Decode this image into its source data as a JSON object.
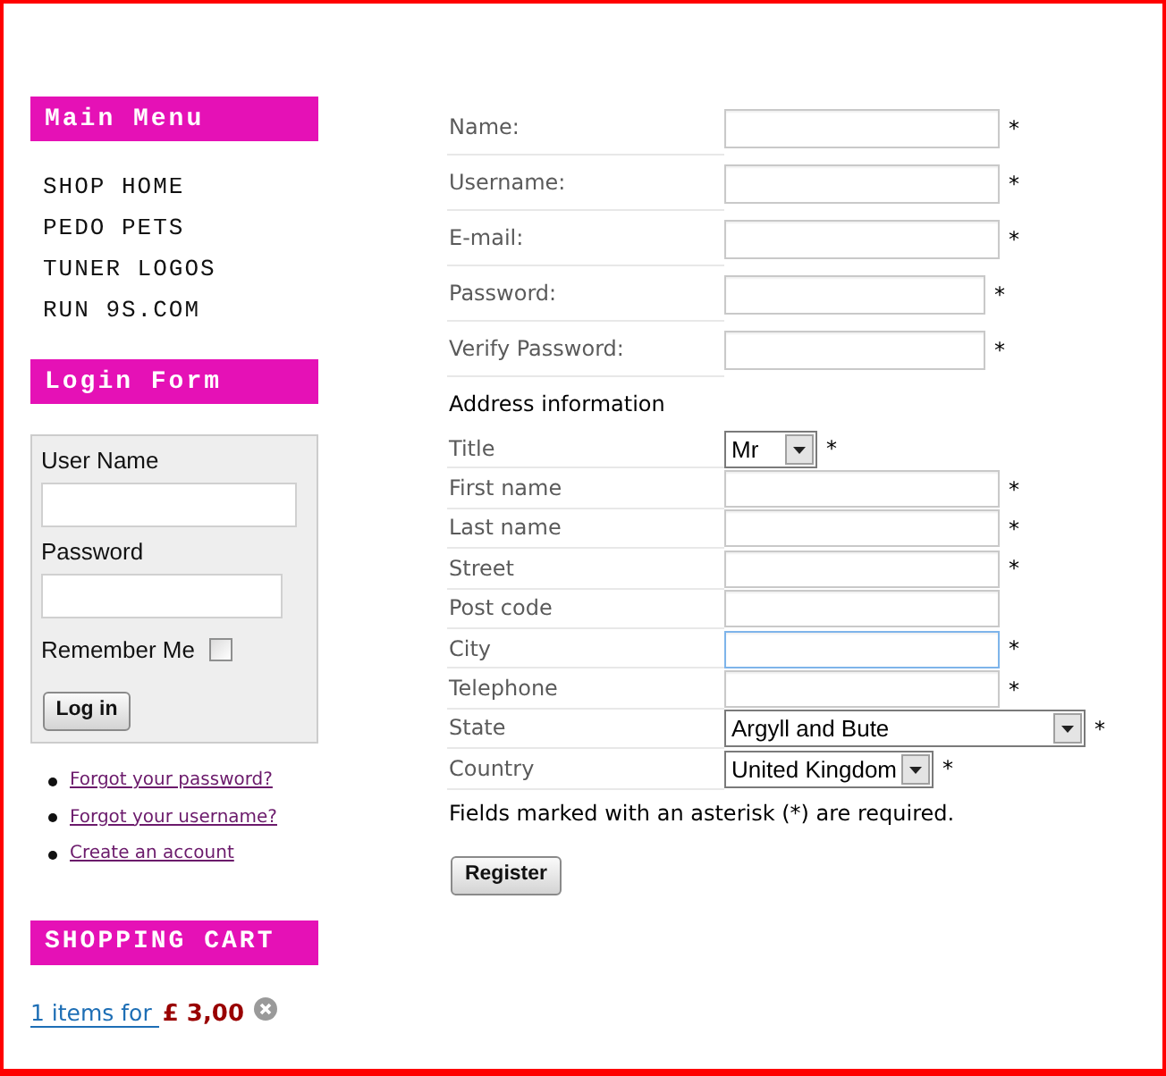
{
  "sidebar": {
    "main_menu": {
      "title": "Main Menu",
      "items": [
        "SHOP HOME",
        "PEDO PETS",
        "TUNER LOGOS",
        "RUN 9S.COM"
      ]
    },
    "login_form": {
      "title": "Login Form",
      "fields": [
        {
          "kind": "text",
          "label": "User Name"
        },
        {
          "kind": "password",
          "label": "Password"
        }
      ],
      "remember_me": {
        "label": "Remember Me",
        "checked": false
      },
      "button": "Log in",
      "links": [
        "Forgot your password?",
        "Forgot your username?",
        "Create an account"
      ]
    },
    "shopping_cart": {
      "title": "SHOPPING CART",
      "summary_link": "1 items for",
      "price": "£ 3,00"
    }
  },
  "registration_form": {
    "fields": [
      {
        "kind": "text",
        "label": "Name:",
        "required_mark": "*"
      },
      {
        "kind": "text",
        "label": "Username:",
        "required_mark": "*"
      },
      {
        "kind": "text",
        "label": "E-mail:",
        "required_mark": "*"
      },
      {
        "kind": "password",
        "label": "Password:",
        "required_mark": "*"
      },
      {
        "kind": "password",
        "label": "Verify Password:",
        "required_mark": "*"
      }
    ],
    "section_title": "Address information",
    "address_fields": [
      {
        "kind": "select",
        "label": "Title",
        "value": "Mr",
        "required_mark": "*",
        "focused": false
      },
      {
        "kind": "text",
        "label": "First name",
        "required_mark": "*",
        "focused": false
      },
      {
        "kind": "text",
        "label": "Last name",
        "required_mark": "*",
        "focused": false
      },
      {
        "kind": "text",
        "label": "Street",
        "required_mark": "*",
        "focused": false
      },
      {
        "kind": "text",
        "label": "Post code",
        "focused": false
      },
      {
        "kind": "text",
        "label": "City",
        "required_mark": "*",
        "focused": true
      },
      {
        "kind": "text",
        "label": "Telephone",
        "required_mark": "*",
        "focused": false
      },
      {
        "kind": "select",
        "label": "State",
        "value": "Argyll and Bute",
        "required_mark": "*",
        "focused": false
      },
      {
        "kind": "select",
        "label": "Country",
        "value": "United Kingdom",
        "required_mark": "*",
        "focused": false
      }
    ],
    "note": "Fields marked with an asterisk (*) are required.",
    "button": "Register"
  }
}
